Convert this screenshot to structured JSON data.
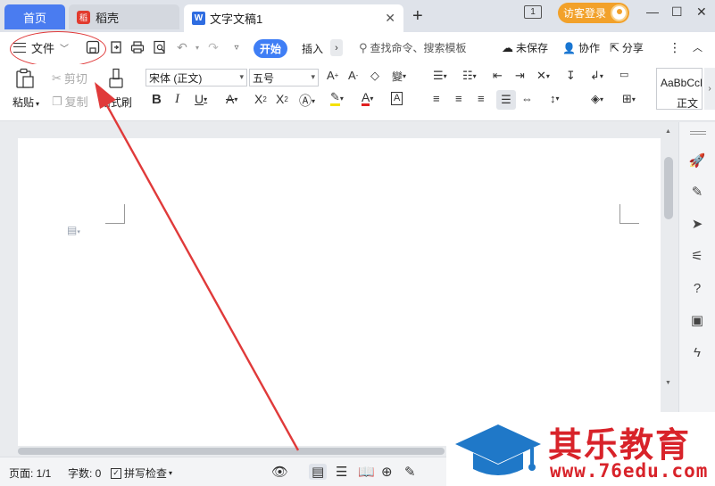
{
  "tabs": {
    "home": "首页",
    "daoke": "稻壳",
    "doc": "文字文稿1",
    "doc_logo": "W",
    "daoke_logo": "稻"
  },
  "titlebar": {
    "badge": "1",
    "guest_login": "访客登录"
  },
  "menu": {
    "file": "文件",
    "start": "开始",
    "insert": "插入",
    "search": "查找命令、搜索模板",
    "unsaved": "未保存",
    "collab": "协作",
    "share": "分享"
  },
  "ribbon": {
    "paste": "粘贴",
    "cut": "剪切",
    "copy": "复制",
    "format_painter": "格式刷",
    "font": "宋体 (正文)",
    "size": "五号",
    "style_preview": "AaBbCcDd",
    "style_name": "正文"
  },
  "status": {
    "page": "页面: 1/1",
    "words": "字数: 0",
    "spell": "拼写检查"
  },
  "watermark": {
    "title": "其乐教育",
    "url": "www.76edu.com"
  },
  "colors": {
    "accent": "#3f7ef5",
    "annotation": "#e03a3a",
    "watermark": "#d8232a"
  }
}
